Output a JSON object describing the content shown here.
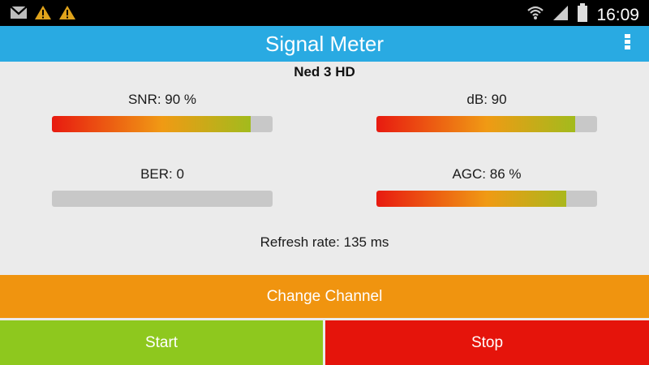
{
  "status_bar": {
    "time": "16:09",
    "icons": [
      "gmail-icon",
      "warning-icon",
      "warning-icon",
      "wifi-icon",
      "signal-icon",
      "battery-icon"
    ]
  },
  "action_bar": {
    "title": "Signal Meter",
    "menu_icon": "overflow-menu-icon"
  },
  "channel": {
    "name": "Ned 3 HD"
  },
  "meters": {
    "snr": {
      "label": "SNR: 90 %",
      "level": 0.9
    },
    "db": {
      "label": "dB: 90",
      "level": 0.9
    },
    "ber": {
      "label": "BER: 0",
      "level": 0
    },
    "agc": {
      "label": "AGC: 86 %",
      "level": 0.86
    }
  },
  "refresh": {
    "text": "Refresh rate: 135 ms"
  },
  "buttons": {
    "change_channel": "Change Channel",
    "start": "Start",
    "stop": "Stop"
  },
  "colors": {
    "action_bar": "#29aae2",
    "change_channel": "#f0940f",
    "start": "#8ec81e",
    "stop": "#e5140b",
    "meter_gradient_start": "#e81a10",
    "meter_gradient_mid": "#f09a14",
    "meter_gradient_end": "#8fc31f",
    "meter_track": "#c8c8c8"
  }
}
